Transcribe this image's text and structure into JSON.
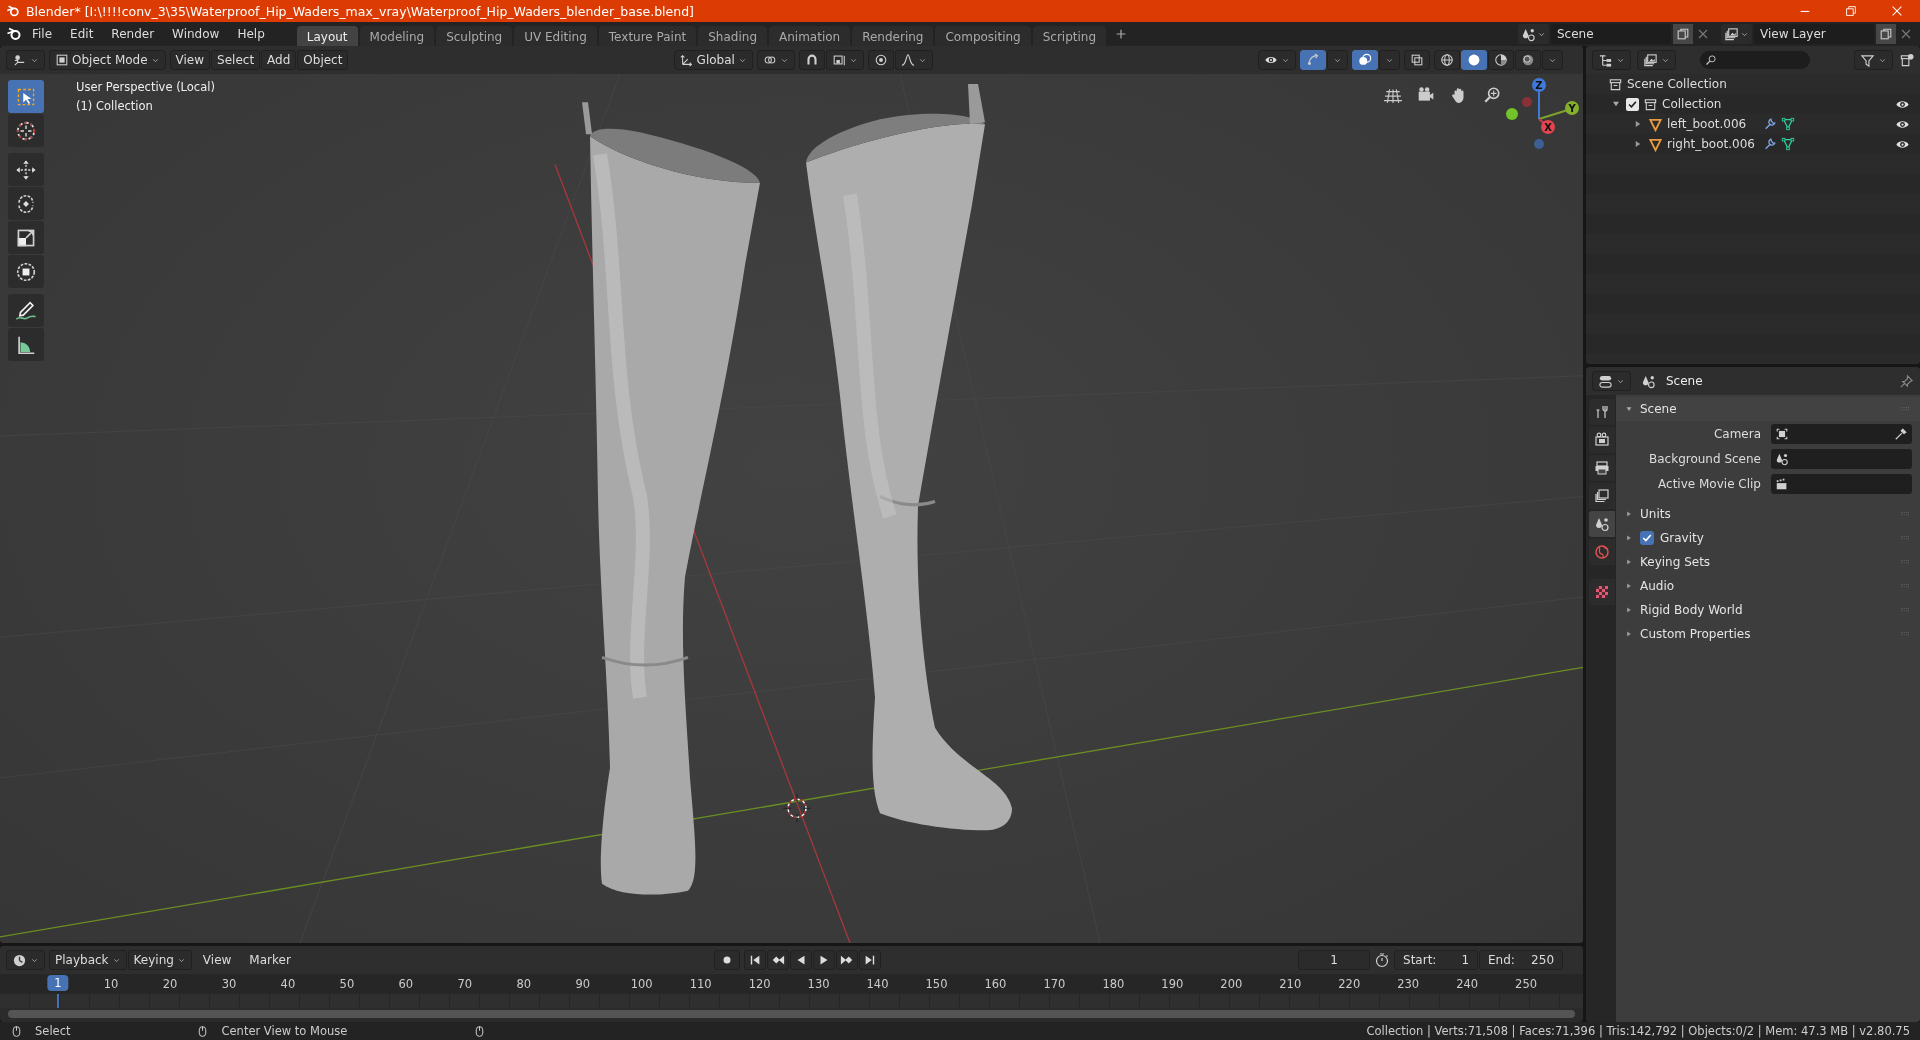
{
  "window": {
    "title": "Blender* [I:\\!!!!conv_3\\35\\Waterproof_Hip_Waders_max_vray\\Waterproof_Hip_Waders_blender_base.blend]"
  },
  "menu": [
    "File",
    "Edit",
    "Render",
    "Window",
    "Help"
  ],
  "workspaces": [
    {
      "label": "Layout",
      "selected": true
    },
    {
      "label": "Modeling",
      "selected": false
    },
    {
      "label": "Sculpting",
      "selected": false
    },
    {
      "label": "UV Editing",
      "selected": false
    },
    {
      "label": "Texture Paint",
      "selected": false
    },
    {
      "label": "Shading",
      "selected": false
    },
    {
      "label": "Animation",
      "selected": false
    },
    {
      "label": "Rendering",
      "selected": false
    },
    {
      "label": "Compositing",
      "selected": false
    },
    {
      "label": "Scripting",
      "selected": false
    }
  ],
  "scene_selector": {
    "value": "Scene"
  },
  "view_layer_selector": {
    "value": "View Layer"
  },
  "viewport": {
    "mode": "Object Mode",
    "menus": [
      "View",
      "Select",
      "Add",
      "Object"
    ],
    "orientation": "Global",
    "shading_modes": [
      {
        "kind": "wireframe",
        "selected": false
      },
      {
        "kind": "solid",
        "selected": true
      },
      {
        "kind": "material",
        "selected": false
      },
      {
        "kind": "rendered",
        "selected": false
      }
    ],
    "overlay_text": [
      "User Perspective (Local)",
      "(1) Collection"
    ],
    "tools": [
      {
        "kind": "select",
        "selected": true
      },
      {
        "kind": "cursor",
        "selected": false
      },
      {
        "kind": "move",
        "selected": false
      },
      {
        "kind": "rotate",
        "selected": false
      },
      {
        "kind": "scale",
        "selected": false
      },
      {
        "kind": "transform",
        "selected": false
      },
      {
        "kind": "annotate",
        "selected": false
      },
      {
        "kind": "measure",
        "selected": false
      }
    ],
    "gizmo_labels": [
      "Z",
      "Y",
      "X"
    ]
  },
  "timeline": {
    "menus": [
      "Playback",
      "Keying",
      "View",
      "Marker"
    ],
    "current_frame": "1",
    "start_label": "Start:",
    "start": "1",
    "end_label": "End:",
    "end": "250",
    "frame_marker": "1",
    "ruler": [
      "10",
      "20",
      "30",
      "40",
      "50",
      "60",
      "70",
      "80",
      "90",
      "100",
      "110",
      "120",
      "130",
      "140",
      "150",
      "160",
      "170",
      "180",
      "190",
      "200",
      "210",
      "220",
      "230",
      "240",
      "250"
    ]
  },
  "outliner": {
    "root": "Scene Collection",
    "items": [
      {
        "label": "Collection",
        "checked": true,
        "expanded": true,
        "visible": true,
        "children": [
          {
            "label": "left_boot.006",
            "expanded": false,
            "visible": true
          },
          {
            "label": "right_boot.006",
            "expanded": false,
            "visible": true
          }
        ]
      }
    ]
  },
  "properties": {
    "context": "Scene",
    "tabs": [
      {
        "kind": "tool",
        "selected": false
      },
      {
        "kind": "render",
        "selected": false
      },
      {
        "kind": "output",
        "selected": false
      },
      {
        "kind": "view_layer",
        "selected": false
      },
      {
        "kind": "scene",
        "selected": true
      },
      {
        "kind": "world",
        "selected": false
      },
      {
        "kind": "texture",
        "selected": false
      }
    ],
    "panels": [
      {
        "kind": "panel",
        "label": "Scene",
        "expanded": true,
        "fields": [
          {
            "kind": "camera",
            "label": "Camera"
          },
          {
            "kind": "scene",
            "label": "Background Scene"
          },
          {
            "kind": "clip",
            "label": "Active Movie Clip"
          }
        ]
      },
      {
        "kind": "panel",
        "label": "Units",
        "expanded": false
      },
      {
        "kind": "checkbox_panel",
        "label": "Gravity",
        "expanded": false,
        "checked": true
      },
      {
        "kind": "panel",
        "label": "Keying Sets",
        "expanded": false
      },
      {
        "kind": "panel",
        "label": "Audio",
        "expanded": false
      },
      {
        "kind": "panel",
        "label": "Rigid Body World",
        "expanded": false
      },
      {
        "kind": "panel",
        "label": "Custom Properties",
        "expanded": false
      }
    ]
  },
  "status_bar": {
    "hints": [
      "Select",
      "Center View to Mouse"
    ],
    "stats": "Collection | Verts:71,508 | Faces:71,396 | Tris:142,792 | Objects:0/2 | Mem: 47.3 MB | v2.80.75"
  }
}
